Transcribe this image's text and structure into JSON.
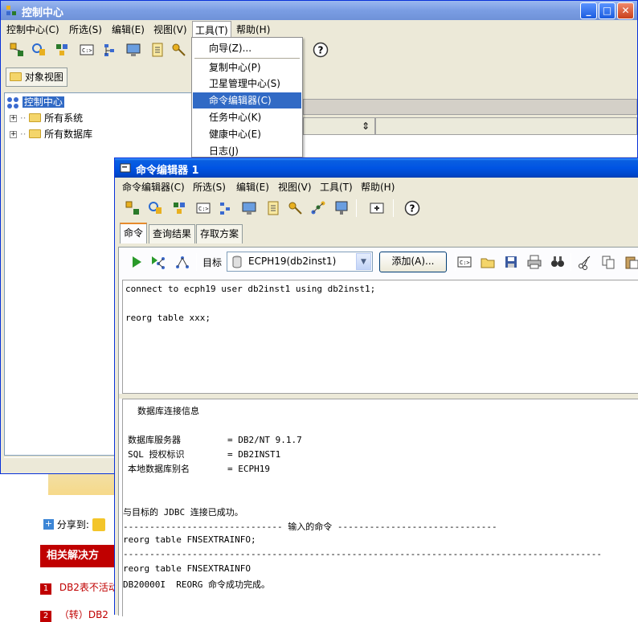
{
  "cc": {
    "title": "控制中心",
    "menu": [
      "控制中心(C)",
      "所选(S)",
      "编辑(E)",
      "视图(V)",
      "工具(T)",
      "帮助(H)"
    ],
    "object_view_tab": "对象视图",
    "tree": {
      "root": "控制中心",
      "items": [
        "所有系统",
        "所有数据库"
      ]
    },
    "tools_menu": [
      "向导(Z)...",
      "复制中心(P)",
      "卫星管理中心(S)",
      "命令编辑器(C)",
      "任务中心(K)",
      "健康中心(E)",
      "日志(J)"
    ]
  },
  "ce": {
    "title": "命令编辑器 1",
    "menu": [
      "命令编辑器(C)",
      "所选(S)",
      "编辑(E)",
      "视图(V)",
      "工具(T)",
      "帮助(H)"
    ],
    "tabs": [
      "命令",
      "查询结果",
      "存取方案"
    ],
    "target_label": "目标",
    "target_value": "ECPH19(db2inst1)",
    "add_button": "添加(A)...",
    "commands": [
      "connect to ecph19 user db2inst1 using db2inst1;",
      "reorg table xxx;"
    ],
    "output": {
      "heading": "数据库连接信息",
      "rows": [
        {
          "label": "数据库服务器",
          "value": "= DB2/NT 9.1.7"
        },
        {
          "label": "SQL 授权标识",
          "value": "= DB2INST1"
        },
        {
          "label": "本地数据库别名",
          "value": "= ECPH19"
        }
      ],
      "jdbc": "与目标的 JDBC 连接已成功。",
      "input_divider": "------------------------------ 输入的命令 ------------------------------",
      "cmd1": "reorg table FNSEXTRAINFO;",
      "divider2": "------------------------------------------------------------------------------------------",
      "cmd2": "reorg table FNSEXTRAINFO",
      "result": "DB20000I  REORG 命令成功完成。"
    }
  },
  "bg": {
    "share": "分享到:",
    "related": "相关解决方",
    "list": [
      {
        "num": "1",
        "text": "DB2表不活动"
      },
      {
        "num": "2",
        "text": "（转）DB2"
      }
    ]
  },
  "colors": {
    "titlebar": "#0054e3",
    "highlight": "#316ac5",
    "web_red": "#c00000"
  }
}
